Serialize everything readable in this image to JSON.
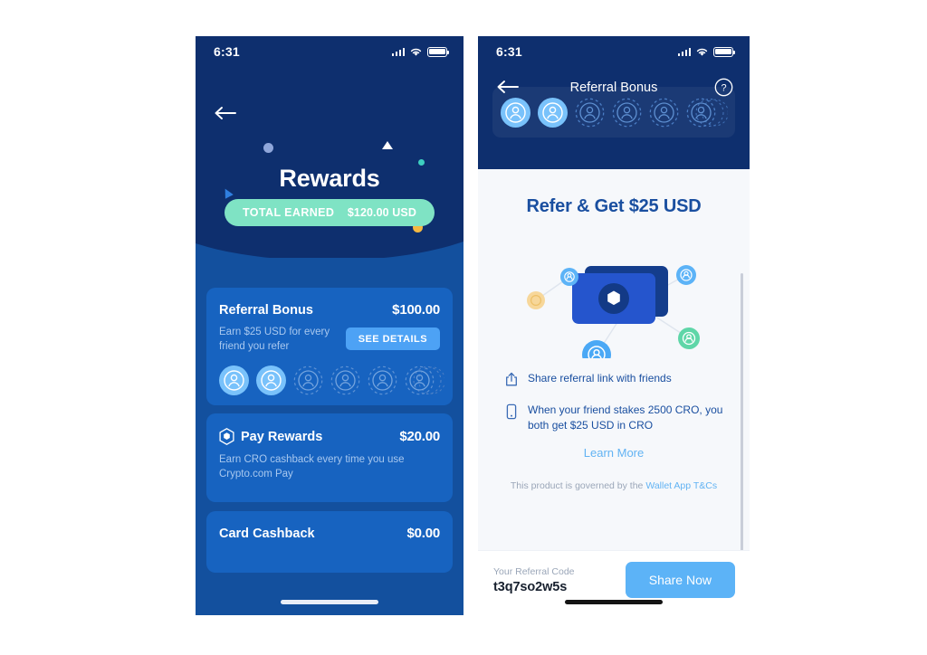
{
  "left_phone": {
    "status": {
      "time": "6:31",
      "signal_icon": "signal-bars-icon",
      "wifi_icon": "wifi-icon",
      "battery_icon": "battery-icon"
    },
    "back_icon": "back-arrow-icon",
    "hero": {
      "title": "Rewards",
      "pill_label": "TOTAL EARNED",
      "pill_amount": "$120.00 USD",
      "pill_color": "#7fe3c4"
    },
    "cards": [
      {
        "name": "referral-bonus",
        "title": "Referral Bonus",
        "amount": "$100.00",
        "subtitle": "Earn $25 USD for every friend you refer",
        "button": "SEE DETAILS",
        "avatars_filled": 2,
        "avatars_total": 6
      },
      {
        "name": "pay-rewards",
        "title": "Pay Rewards",
        "amount": "$20.00",
        "subtitle": "Earn CRO cashback every time you use Crypto.com Pay",
        "icon": "cro-logo-icon"
      },
      {
        "name": "card-cashback",
        "title": "Card Cashback",
        "amount": "$0.00"
      }
    ]
  },
  "right_phone": {
    "status": {
      "time": "6:31",
      "signal_icon": "signal-bars-icon",
      "wifi_icon": "wifi-icon",
      "battery_icon": "battery-icon"
    },
    "nav": {
      "title": "Referral Bonus",
      "back_icon": "back-arrow-icon",
      "help_icon": "help-circle-icon"
    },
    "avatars_filled": 2,
    "avatars_total": 6,
    "heading": "Refer & Get $25 USD",
    "illustration": "banknotes-with-contacts-illustration",
    "bullets": [
      {
        "icon": "share-icon",
        "text": "Share referral link with friends"
      },
      {
        "icon": "mobile-phone-icon",
        "text": "When your friend stakes 2500 CRO, you both get $25 USD in CRO"
      }
    ],
    "learn_more": "Learn More",
    "governance_prefix": "This product is governed by the ",
    "governance_link": "Wallet App T&Cs",
    "footer": {
      "code_label": "Your Referral Code",
      "code_value": "t3q7so2w5s",
      "share_button": "Share Now"
    }
  },
  "colors": {
    "navy": "#0e2f6e",
    "blue_body": "#13509e",
    "card_blue": "#1763c0",
    "accent_blue": "#4da2f5",
    "mint": "#7fe3c4",
    "light_bg": "#f6f8fb"
  }
}
